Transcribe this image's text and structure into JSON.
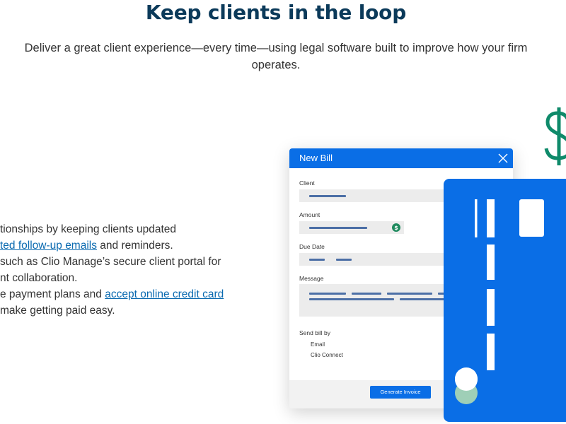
{
  "heading": "Keep clients in the loop",
  "subtext": "Deliver a great client experience—every time—using legal software built to improve how your firm operates.",
  "bullets": {
    "line1": "tionships by keeping clients updated",
    "line2_link": "ted follow-up emails",
    "line2_rest": " and reminders.",
    "line3": " such as Clio Manage’s secure client portal for",
    "line4": "nt collaboration.",
    "line5_pre": "e payment plans and ",
    "line5_link": "accept online credit card",
    "line6": "make getting paid easy."
  },
  "bill": {
    "title": "New Bill",
    "client_label": "Client",
    "amount_label": "Amount",
    "due_date_label": "Due Date",
    "message_label": "Message",
    "send_by_label": "Send bill by",
    "option_email": "Email",
    "option_clio_connect": "Clio Connect",
    "generate_button": "Generate Invoice"
  },
  "colors": {
    "heading": "#0b3a5a",
    "brand_blue": "#0a6ee6",
    "link": "#0a6ab0",
    "dollar_green": "#0f8a6a",
    "mint": "#9fcfb7"
  },
  "icons": [
    "close-icon",
    "coin-icon",
    "dollar-sign-icon"
  ]
}
